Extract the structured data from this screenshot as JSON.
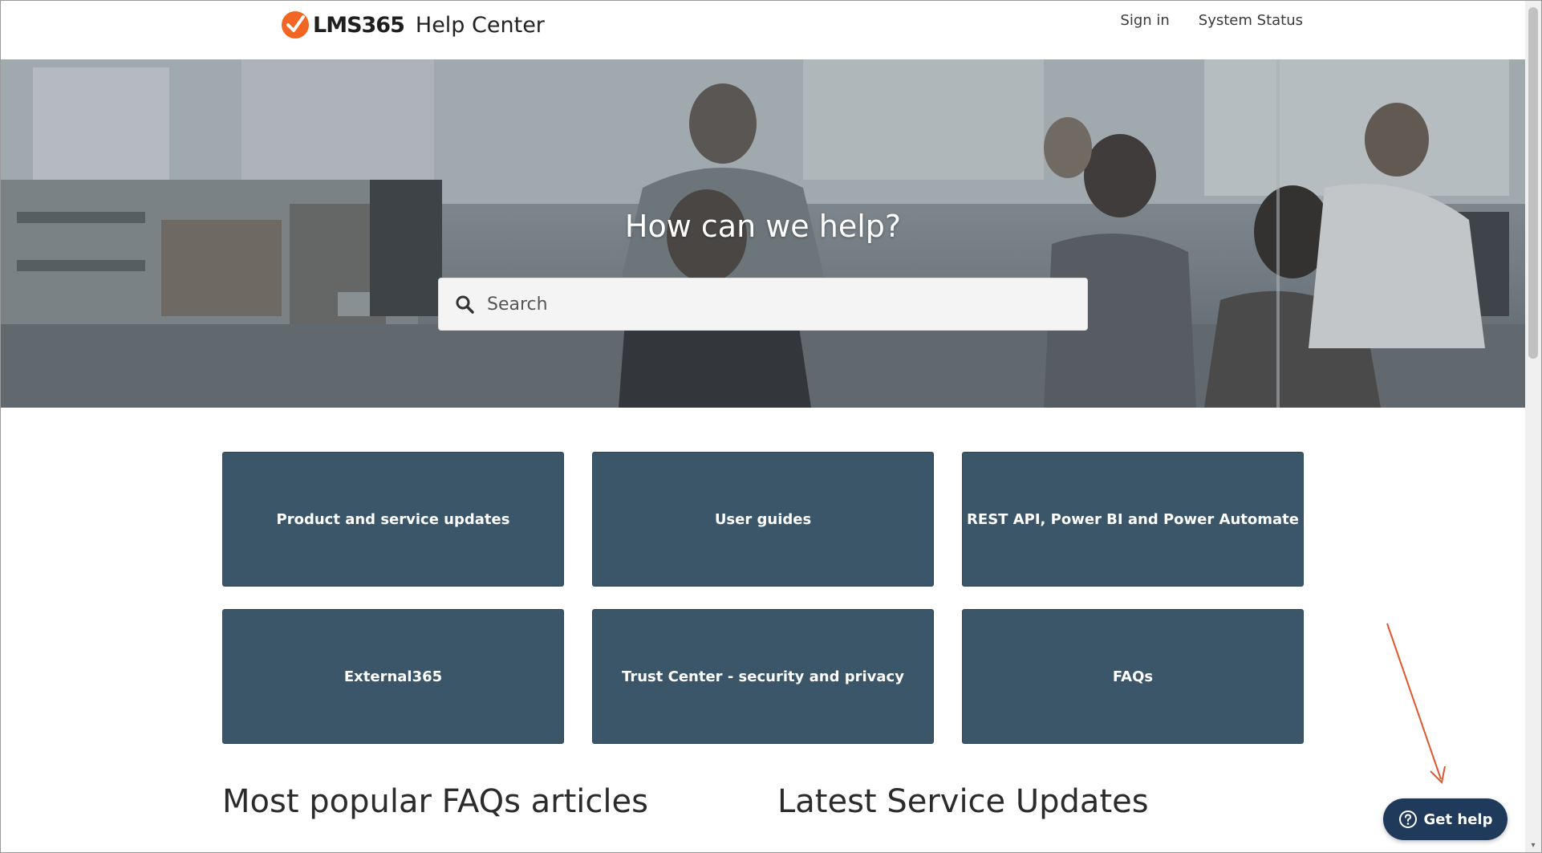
{
  "header": {
    "logo_text": "LMS365",
    "logo_subtitle": "Help Center",
    "nav": [
      {
        "label": "Sign in"
      },
      {
        "label": "System Status"
      }
    ]
  },
  "hero": {
    "title": "How can we help?",
    "search_placeholder": "Search"
  },
  "tiles": [
    {
      "label": "Product and service updates"
    },
    {
      "label": "User guides"
    },
    {
      "label": "REST API, Power BI and Power Automate"
    },
    {
      "label": "External365"
    },
    {
      "label": "Trust Center - security and privacy"
    },
    {
      "label": "FAQs"
    }
  ],
  "sections": {
    "popular_title": "Most popular FAQs articles",
    "updates_title": "Latest Service Updates"
  },
  "get_help": {
    "label": "Get help"
  },
  "colors": {
    "tile_bg": "#3b5569",
    "logo_orange": "#f26522",
    "help_button": "#1f3a5a",
    "annotation_arrow": "#e0572a"
  }
}
